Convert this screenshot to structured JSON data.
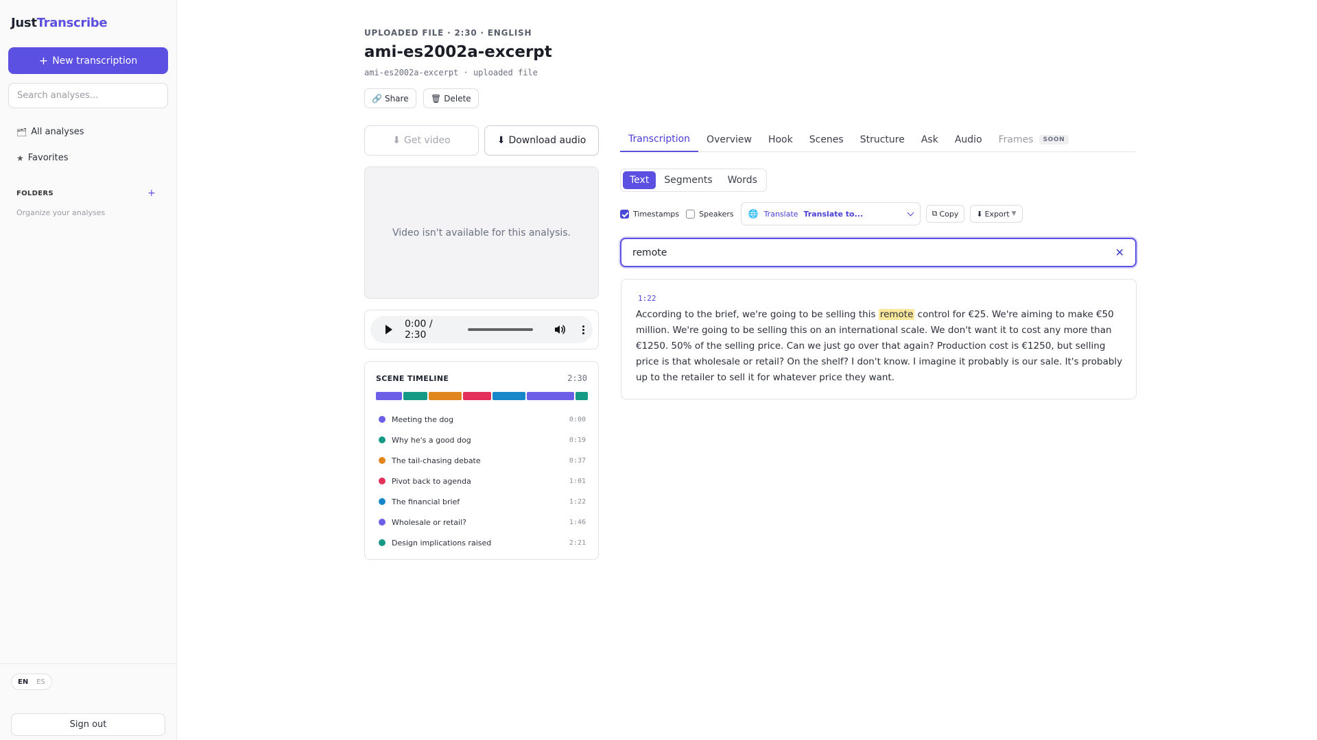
{
  "app": {
    "logo_part1": "Just",
    "logo_part2": "Transcribe"
  },
  "sidebar": {
    "new_button": "New transcription",
    "search_placeholder": "Search analyses...",
    "nav": [
      {
        "icon": "folder-icon",
        "label": "All analyses"
      },
      {
        "icon": "star-icon",
        "label": "Favorites"
      }
    ],
    "folders_heading": "FOLDERS",
    "folders_add": "+",
    "folders_empty": "Organize your analyses",
    "lang": [
      "EN",
      "ES"
    ],
    "lang_selected": "EN",
    "signout": "Sign out"
  },
  "header": {
    "meta": "UPLOADED FILE · 2:30 · ENGLISH",
    "title": "ami-es2002a-excerpt",
    "subtitle": "ami-es2002a-excerpt · uploaded file",
    "share": "Share",
    "delete": "Delete"
  },
  "media": {
    "get_video": "Get video",
    "download_audio": "Download audio",
    "video_unavailable": "Video isn't available for this analysis.",
    "player_time": "0:00 / 2:30",
    "progress": 0
  },
  "timeline": {
    "title": "SCENE TIMELINE",
    "duration": "2:30",
    "scenes": [
      {
        "name": "Meeting the dog",
        "time": "0:00",
        "color": "#6a5fe6"
      },
      {
        "name": "Why he's a good dog",
        "time": "0:19",
        "color": "#159a86"
      },
      {
        "name": "The tail-chasing debate",
        "time": "0:37",
        "color": "#e0861c"
      },
      {
        "name": "Pivot back to agenda",
        "time": "1:01",
        "color": "#e3305a"
      },
      {
        "name": "The financial brief",
        "time": "1:22",
        "color": "#1787c9"
      },
      {
        "name": "Wholesale or retail?",
        "time": "1:46",
        "color": "#6a5fe6"
      },
      {
        "name": "Design implications raised",
        "time": "2:21",
        "color": "#159a86"
      }
    ]
  },
  "tabs": {
    "items": [
      "Transcription",
      "Overview",
      "Hook",
      "Scenes",
      "Structure",
      "Ask",
      "Audio",
      "Frames"
    ],
    "active": "Transcription",
    "soon_badge": "SOON"
  },
  "view_toggle": {
    "items": [
      "Text",
      "Segments",
      "Words"
    ],
    "active": "Text"
  },
  "options": {
    "timestamps": {
      "label": "Timestamps",
      "checked": true
    },
    "speakers": {
      "label": "Speakers",
      "checked": false
    },
    "translate_label": "Translate",
    "translate_value": "Translate to...",
    "copy": "Copy",
    "export": "Export"
  },
  "find": {
    "value": "remote"
  },
  "transcript": {
    "timestamp": "1:22",
    "before": "According to the brief, we're going to be selling this ",
    "highlight": "remote",
    "after": " control for €25. We're aiming to make €50 million. We're going to be selling this on an international scale. We don't want it to cost any more than €1250. 50% of the selling price. Can we just go over that again? Production cost is €1250, but selling price is that wholesale or retail? On the shelf? I don't know. I imagine it probably is our sale. It's probably up to the retailer to sell it for whatever price they want."
  }
}
